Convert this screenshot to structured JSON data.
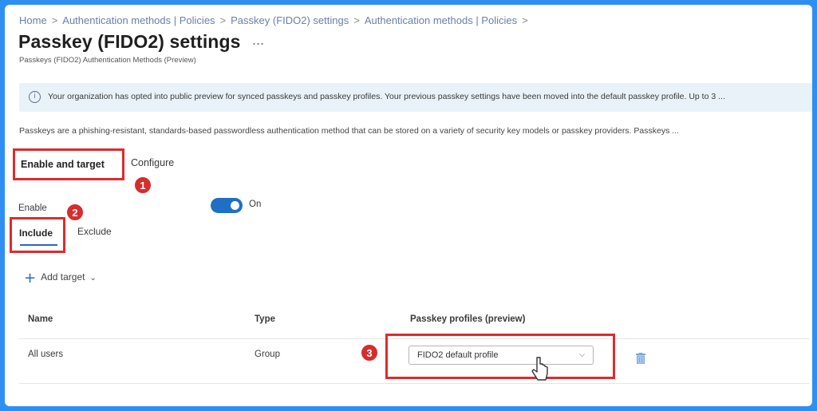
{
  "breadcrumb": [
    {
      "label": "Home"
    },
    {
      "label": "Authentication methods | Policies"
    },
    {
      "label": "Passkey (FIDO2) settings"
    },
    {
      "label": "Authentication methods | Policies"
    }
  ],
  "breadcrumb_separator": ">",
  "page": {
    "title": "Passkey (FIDO2) settings",
    "more": "...",
    "subtitle": "Passkeys (FIDO2) Authentication Methods (Preview)"
  },
  "info_banner": {
    "icon": "info-icon",
    "text": "Your organization has opted into public preview for synced passkeys and passkey profiles. Your previous passkey settings have been moved into the default passkey profile. Up to 3 ..."
  },
  "description": "Passkeys are a phishing-resistant, standards-based passwordless authentication method that can be stored on a variety of security key models or passkey providers. Passkeys ...",
  "tabs": {
    "enable_and_target": "Enable and target",
    "configure": "Configure"
  },
  "enable": {
    "label": "Enable",
    "state": "On"
  },
  "subtabs": {
    "include": "Include",
    "exclude": "Exclude"
  },
  "add_target": {
    "label": "Add target"
  },
  "table": {
    "columns": [
      "Name",
      "Type",
      "Passkey profiles (preview)"
    ],
    "rows": [
      {
        "name": "All users",
        "type": "Group",
        "profile": "FIDO2 default profile"
      }
    ]
  },
  "callouts": [
    "1",
    "2",
    "3"
  ],
  "colors": {
    "frame_border": "#2f8ff0",
    "accent": "#1f6fc4",
    "callout_red": "#e02b2b",
    "info_bg": "#e9f2f9"
  }
}
